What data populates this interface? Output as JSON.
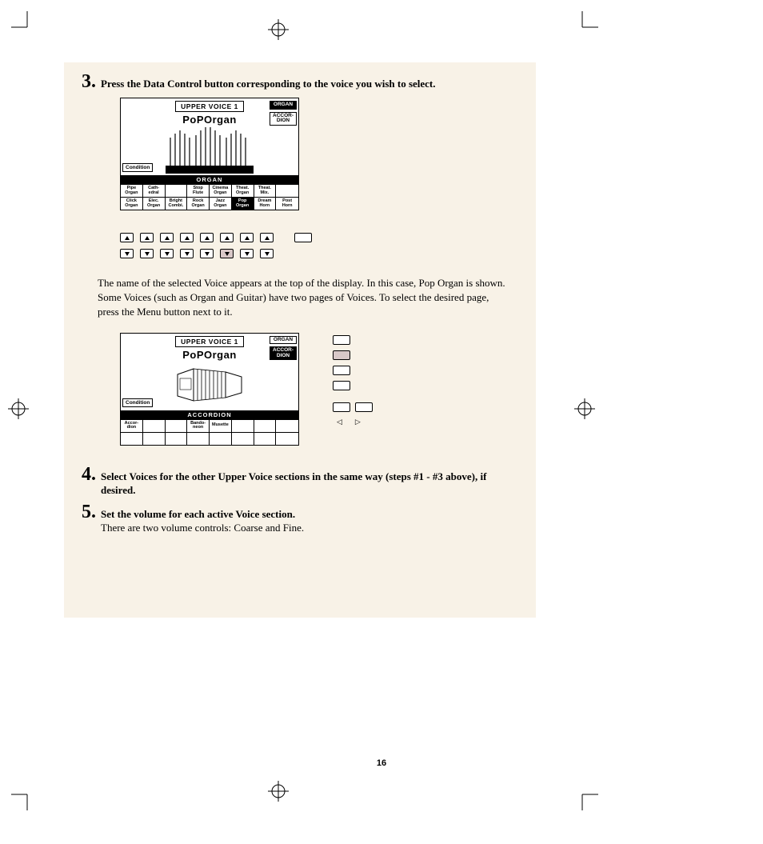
{
  "page_number": "16",
  "steps": {
    "s3": {
      "num": "3",
      "text": "Press the Data Control button corresponding to the voice you wish to select."
    },
    "s4": {
      "num": "4",
      "text": "Select Voices for the other Upper Voice sections in the same way (steps #1 - #3 above), if desired."
    },
    "s5": {
      "num": "5",
      "text": "Set the volume for each active Voice section.",
      "sub": "There are two volume controls: Coarse and Fine."
    }
  },
  "paragraph": "The name of the selected Voice appears at the top of the display.  In this case, Pop Organ is shown.\nSome Voices (such as Organ and Guitar) have two pages of Voices.  To select the desired page, press the Menu button next to it.",
  "lcd1": {
    "title": "UPPER VOICE 1",
    "sub": "PoPOrgan",
    "side": [
      "ORGAN",
      "ACCOR-\nDION"
    ],
    "cond": "Condition",
    "bar": "ORGAN",
    "row1": [
      "Pipe\nOrgan",
      "Cath-\nedral",
      "",
      "Stop\nFlute",
      "Cinema\nOrgan",
      "Theat.\nOrgan",
      "Theat.\nMix.",
      ""
    ],
    "row2": [
      "Click\nOrgan",
      "Elec.\nOrgan",
      "Bright\nCombi.",
      "Rock\nOrgan",
      "Jazz\nOrgan",
      "Pop\nOrgan",
      "Dream\nHorn",
      "Post\nHorn"
    ]
  },
  "lcd2": {
    "title": "UPPER VOICE 1",
    "sub": "PoPOrgan",
    "side": [
      "ORGAN",
      "ACCOR-\nDION"
    ],
    "cond": "Condition",
    "bar": "ACCORDION",
    "row1": [
      "Accor-\ndion",
      "",
      "",
      "Bando-\nneon",
      "Musette",
      "",
      "",
      ""
    ],
    "row2": [
      "",
      "",
      "",
      "",
      "",
      "",
      "",
      ""
    ]
  }
}
